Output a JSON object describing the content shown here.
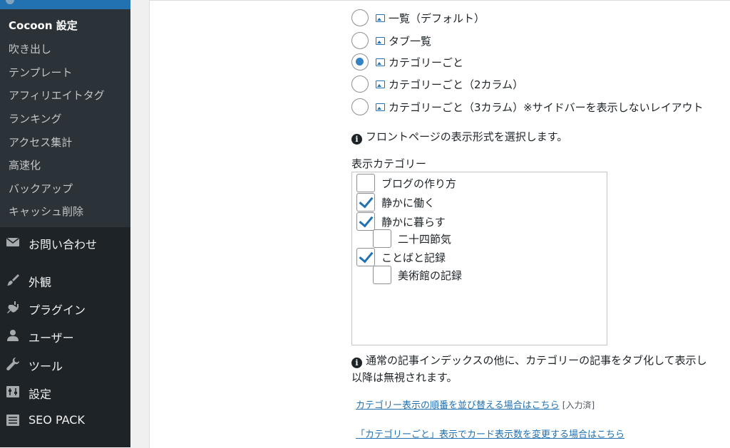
{
  "sidebar": {
    "submenu": [
      {
        "label": "Cocoon 設定",
        "current": true
      },
      {
        "label": "吹き出し"
      },
      {
        "label": "テンプレート"
      },
      {
        "label": "アフィリエイトタグ"
      },
      {
        "label": "ランキング"
      },
      {
        "label": "アクセス集計"
      },
      {
        "label": "高速化"
      },
      {
        "label": "バックアップ"
      },
      {
        "label": "キャッシュ削除"
      }
    ],
    "menu": [
      {
        "label": "お問い合わせ",
        "icon": "envelope-icon"
      },
      {
        "label": "外観",
        "icon": "paintbrush-icon"
      },
      {
        "label": "プラグイン",
        "icon": "plugin-icon"
      },
      {
        "label": "ユーザー",
        "icon": "user-icon"
      },
      {
        "label": "ツール",
        "icon": "wrench-icon"
      },
      {
        "label": "設定",
        "icon": "settings-icon"
      },
      {
        "label": "SEO PACK",
        "icon": "list-icon"
      }
    ]
  },
  "front_page": {
    "options": [
      {
        "label": "一覧（デフォルト）",
        "checked": false
      },
      {
        "label": "タブ一覧",
        "checked": false
      },
      {
        "label": "カテゴリーごと",
        "checked": true
      },
      {
        "label": "カテゴリーごと（2カラム）",
        "checked": false
      },
      {
        "label": "カテゴリーごと（3カラム）※サイドバーを表示しないレイアウト",
        "checked": false
      }
    ],
    "info": "フロントページの表示形式を選択します。",
    "categories_label": "表示カテゴリー",
    "categories": [
      {
        "label": "ブログの作り方",
        "checked": false,
        "level": 0
      },
      {
        "label": "静かに働く",
        "checked": true,
        "level": 0
      },
      {
        "label": "静かに暮らす",
        "checked": true,
        "level": 0
      },
      {
        "label": "二十四節気",
        "checked": false,
        "level": 1
      },
      {
        "label": "ことばと記録",
        "checked": true,
        "level": 0
      },
      {
        "label": "美術館の記録",
        "checked": false,
        "level": 1
      }
    ],
    "info2_line1": "通常の記事インデックスの他に、カテゴリーの記事をタブ化して表示し",
    "info2_line2": "以降は無視されます。",
    "link1": "カテゴリー表示の順番を並び替える場合はこちら",
    "link1_note": "[入力済]",
    "link2": "「カテゴリーごと」表示でカード表示数を変更する場合はこちら"
  },
  "colors": {
    "sidebar_bg": "#1d2327",
    "submenu_bg": "#2c3338",
    "accent": "#2271b1",
    "radio_checked": "#3582c4"
  }
}
